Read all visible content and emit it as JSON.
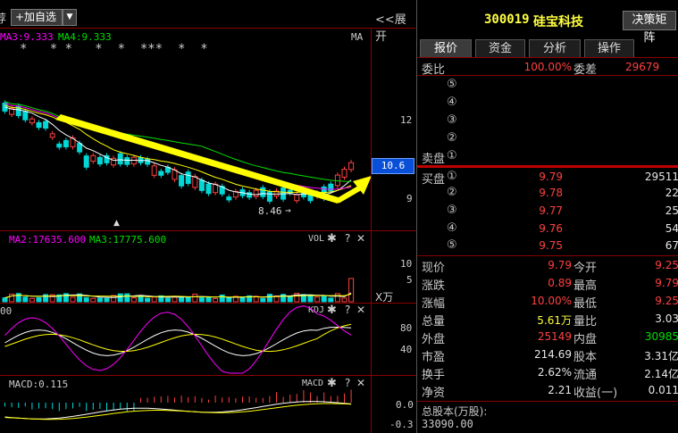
{
  "toolbar": {
    "partial_left_char": "荐",
    "add_watch_label": "+加自选",
    "dropdown_glyph": "▼",
    "expand_label": "<<展开",
    "stock_code": "300019",
    "stock_name": "硅宝科技",
    "decision_label": "决策矩阵"
  },
  "tabs": [
    "报价",
    "资金",
    "分析",
    "操作"
  ],
  "chart_panels": {
    "main": {
      "ma3_label": "MA3:9.333",
      "ma4_label": "MA4:9.333",
      "indicator_label": "MA",
      "stars": "*   * *   *  *  ***  *  *",
      "price_ticks": [
        "12",
        "9"
      ],
      "current_price_tag": "10.6",
      "low_marker": "8.46",
      "low_arrow": "→",
      "caret": "▲"
    },
    "volume": {
      "ma2_label": "MA2:17635.600",
      "ma3_label": "MA3:17775.600",
      "name": "VOL",
      "ticks": [
        "10",
        "5"
      ],
      "unit": "X万"
    },
    "kdj": {
      "partial_label": "00",
      "name": "KDJ",
      "ticks": [
        "80",
        "40"
      ]
    },
    "macd": {
      "label": "MACD:0.115",
      "name": "MACD",
      "ticks": [
        "0.0",
        "-0.3"
      ]
    },
    "tool_glyphs": {
      "gear": "✱",
      "help": "?",
      "close": "✕"
    }
  },
  "orderbook": {
    "weibi_label": "委比",
    "weibi_value": "100.00%",
    "weicha_label": "委差",
    "weicha_value": "29679",
    "sell_levels": [
      "⑤",
      "④",
      "③",
      "②",
      "①"
    ],
    "sell_label": "卖盘",
    "buy_label": "买盘",
    "buy": [
      {
        "level": "①",
        "price": "9.79",
        "volume": "29511"
      },
      {
        "level": "②",
        "price": "9.78",
        "volume": "22"
      },
      {
        "level": "③",
        "price": "9.77",
        "volume": "25"
      },
      {
        "level": "④",
        "price": "9.76",
        "volume": "54"
      },
      {
        "level": "⑤",
        "price": "9.75",
        "volume": "67"
      }
    ]
  },
  "quote": [
    {
      "l1": "现价",
      "v1": "9.79",
      "c1": "red",
      "l2": "今开",
      "v2": "9.25",
      "c2": "red"
    },
    {
      "l1": "涨跌",
      "v1": "0.89",
      "c1": "red",
      "l2": "最高",
      "v2": "9.79",
      "c2": "red"
    },
    {
      "l1": "涨幅",
      "v1": "10.00%",
      "c1": "red",
      "l2": "最低",
      "v2": "9.25",
      "c2": "red"
    },
    {
      "l1": "总量",
      "v1": "5.61万",
      "c1": "yellow",
      "l2": "量比",
      "v2": "3.03",
      "c2": "white"
    },
    {
      "l1": "外盘",
      "v1": "25149",
      "c1": "red",
      "l2": "内盘",
      "v2": "30985",
      "c2": "green"
    },
    {
      "l1": "市盈",
      "v1": "214.69",
      "c1": "white",
      "l2": "股本",
      "v2": "3.31亿",
      "c2": "white"
    },
    {
      "l1": "换手",
      "v1": "2.62%",
      "c1": "white",
      "l2": "流通",
      "v2": "2.14亿",
      "c2": "white"
    },
    {
      "l1": "净资",
      "v1": "2.21",
      "c1": "white",
      "l2": "收益(一)",
      "v2": "0.011",
      "c2": "white"
    }
  ],
  "footer": {
    "total_shares_label": "总股本(万股):",
    "total_shares_value": "33090.00"
  },
  "colors": {
    "up": "#ff4040",
    "down": "#00d8d8",
    "ma_white": "#ffffff",
    "ma_yellow": "#ffff00",
    "ma_magenta": "#ff00ff",
    "ma_green": "#00e000",
    "divider": "#c00000"
  }
}
